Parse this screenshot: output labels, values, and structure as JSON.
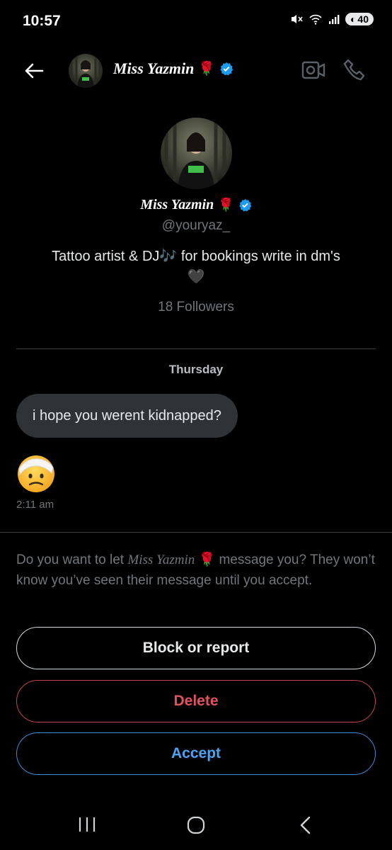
{
  "status_bar": {
    "time": "10:57",
    "battery": "40",
    "signal_label": "5"
  },
  "header": {
    "name": "Miss Yazmin",
    "rose": "🌹"
  },
  "profile": {
    "name": "Miss Yazmin",
    "rose": "🌹",
    "handle": "@youryaz_",
    "bio_prefix": "Tattoo artist & DJ",
    "bio_notes": "🎶",
    "bio_suffix": " for bookings write in dm's",
    "bio_heart": "🖤",
    "followers": "18 Followers"
  },
  "conversation": {
    "day_label": "Thursday",
    "messages": [
      {
        "text": "i hope you werent kidnapped?"
      },
      {
        "emoji": "face-with-head-bandage",
        "time": "2:11 am"
      }
    ]
  },
  "request": {
    "prefix": "Do you want to let ",
    "name": "Miss Yazmin",
    "rose": "🌹",
    "suffix": " message you? They won’t know you’ve seen their message until you accept."
  },
  "actions": {
    "block_label": "Block or report",
    "delete_label": "Delete",
    "accept_label": "Accept"
  },
  "colors": {
    "verified": "#1d9bf0",
    "delete": "#e0535d",
    "accept": "#4ba4f3"
  }
}
